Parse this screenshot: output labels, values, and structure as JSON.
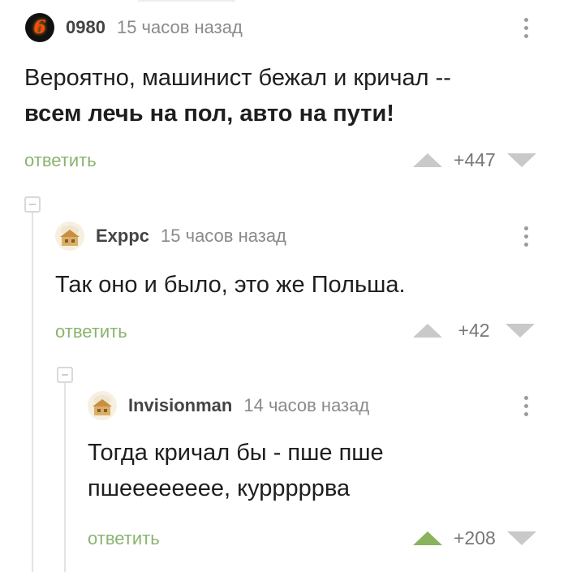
{
  "comments": [
    {
      "username": "0980",
      "time": "15 часов назад",
      "text_line1": "Вероятно, машинист бежал и кричал --",
      "text_line2": "всем лечь на пол, авто на пути!",
      "reply_label": "ответить",
      "rating": "+447",
      "upvoted": false
    },
    {
      "username": "Exppc",
      "time": "15 часов назад",
      "text_line1": "Так оно и было, это же Польша.",
      "reply_label": "ответить",
      "rating": "+42",
      "upvoted": false
    },
    {
      "username": "Invisionman",
      "time": "14 часов назад",
      "text_line1": "Тогда кричал бы - пше пше",
      "text_line2": "пшееееееее, курррррва",
      "reply_label": "ответить",
      "rating": "+208",
      "upvoted": true
    }
  ],
  "avatar_glyph": "6",
  "colors": {
    "reply": "#8ab36f",
    "upvote_active": "#8ab35f",
    "muted": "#c9c9c9"
  }
}
